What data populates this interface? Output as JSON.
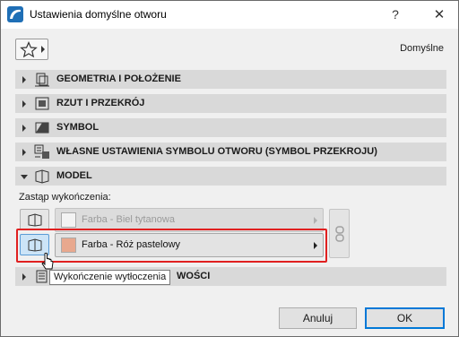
{
  "window": {
    "title": "Ustawienia domyślne otworu",
    "help_glyph": "?",
    "close_glyph": "✕"
  },
  "toolbar": {
    "favorites_icon": "star-icon",
    "default_label": "Domyślne"
  },
  "panels": [
    {
      "label": "GEOMETRIA I POŁOŻENIE",
      "expanded": false,
      "icon": "geometry-icon"
    },
    {
      "label": "RZUT I PRZEKRÓJ",
      "expanded": false,
      "icon": "plan-section-icon"
    },
    {
      "label": "SYMBOL",
      "expanded": false,
      "icon": "symbol-icon"
    },
    {
      "label": "WŁASNE USTAWIENIA SYMBOLU OTWORU (SYMBOL PRZEKROJU)",
      "expanded": false,
      "icon": "custom-symbol-icon"
    },
    {
      "label": "MODEL",
      "expanded": true,
      "icon": "model-icon"
    },
    {
      "label": "WOŚCI",
      "expanded": false,
      "icon": "properties-icon"
    }
  ],
  "model": {
    "override_label": "Zastąp wykończenia:",
    "rows": [
      {
        "paint": "Farba - Biel tytanowa",
        "swatch_color": "#f3f3f3",
        "enabled": false
      },
      {
        "paint": "Farba - Róż pastelowy",
        "swatch_color": "#e8a88e",
        "enabled": true
      }
    ],
    "tooltip": "Wykończenie wytłoczenia"
  },
  "buttons": {
    "cancel": "Anuluj",
    "ok": "OK"
  },
  "colors": {
    "highlight": "#e02020",
    "accent": "#0078d7"
  }
}
